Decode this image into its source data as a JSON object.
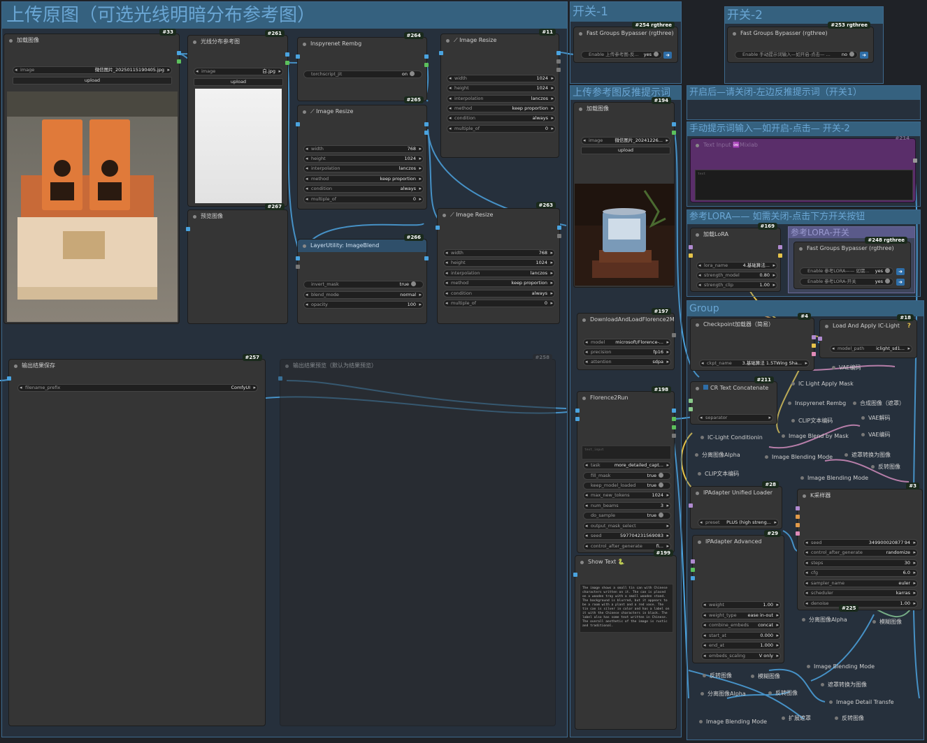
{
  "groups": {
    "main": "上传原图（可选光线明暗分布参考图）",
    "switch1": "开关-1",
    "switch2": "开关-2",
    "ref_reverse": "上传参考图反推提示词",
    "after_open": "开启后—请关闭-左边反推提示词（开关1）",
    "manual_prompt": "手动提示词输入—如开启-点击— 开关-2",
    "ref_lora": "参考LORA—— 如需关闭-点击下方开关按钮",
    "lora_switch": "参考LORA-开关",
    "group": "Group"
  },
  "nodes": {
    "load_image": {
      "title": "加载图像",
      "id": "#33",
      "image_label": "image",
      "image_value": "微信图片_20250115190405.jpg",
      "upload": "upload"
    },
    "light_ref": {
      "title": "光线分布参考图",
      "id": "#261",
      "image_label": "image",
      "image_value": "白.jpg",
      "upload": "upload"
    },
    "preview": {
      "title": "预览图像",
      "id": "#267"
    },
    "inspyrenet": {
      "title": "Inspyrenet Rembg",
      "id": "#264",
      "w_label": "torchscript_jit",
      "w_value": "on"
    },
    "resize265": {
      "title": "Image Resize",
      "id": "#265",
      "widgets": [
        [
          "width",
          "768"
        ],
        [
          "height",
          "1024"
        ],
        [
          "interpolation",
          "lanczos"
        ],
        [
          "method",
          "keep proportion"
        ],
        [
          "condition",
          "always"
        ],
        [
          "multiple_of",
          "0"
        ]
      ]
    },
    "resize11": {
      "title": "Image Resize",
      "id": "#11",
      "widgets": [
        [
          "width",
          "1024"
        ],
        [
          "height",
          "1024"
        ],
        [
          "interpolation",
          "lanczos"
        ],
        [
          "method",
          "keep proportion"
        ],
        [
          "condition",
          "always"
        ],
        [
          "multiple_of",
          "0"
        ]
      ]
    },
    "resize263": {
      "title": "Image Resize",
      "id": "#263",
      "widgets": [
        [
          "width",
          "768"
        ],
        [
          "height",
          "1024"
        ],
        [
          "interpolation",
          "lanczos"
        ],
        [
          "method",
          "keep proportion"
        ],
        [
          "condition",
          "always"
        ],
        [
          "multiple_of",
          "0"
        ]
      ]
    },
    "blend266": {
      "title": "LayerUtility: ImageBlend",
      "id": "#266",
      "widgets": [
        [
          "invert_mask",
          "true"
        ],
        [
          "blend_mode",
          "normal"
        ],
        [
          "opacity",
          "100"
        ]
      ]
    },
    "save257": {
      "title": "输出结果保存",
      "id": "#257",
      "prefix_label": "filename_prefix",
      "prefix_value": "ComfyUI"
    },
    "preview258": {
      "title": "输出结果预览（默认为结果预览）",
      "id": "#258"
    },
    "bypass254": {
      "title": "Fast Groups Bypasser (rgthree)",
      "id": "#254 rgthree",
      "toggle_label": "Enable 上传参考图-反...",
      "toggle_value": "yes"
    },
    "bypass253": {
      "title": "Fast Groups Bypasser (rgthree)",
      "id": "#253 rgthree",
      "toggle_label": "Enable 手动提示词输入—如开启-点击— ...",
      "toggle_value": "no"
    },
    "load194": {
      "title": "加载图像",
      "id": "#194",
      "image_label": "image",
      "image_value": "微信图片_20241226...",
      "upload": "upload"
    },
    "florence197": {
      "title": "DownloadAndLoadFlorence2Model",
      "id": "#197",
      "widgets": [
        [
          "model",
          "microsoft/Florence-..."
        ],
        [
          "precision",
          "fp16"
        ],
        [
          "attention",
          "sdpa"
        ]
      ]
    },
    "florence_run": {
      "title": "Florence2Run",
      "id": "#198",
      "text_placeholder": "text_input",
      "widgets": [
        [
          "task",
          "more_detailed_capt..."
        ],
        [
          "fill_mask",
          "true"
        ],
        [
          "keep_model_loaded",
          "true"
        ],
        [
          "max_new_tokens",
          "1024"
        ],
        [
          "num_beams",
          "3"
        ],
        [
          "do_sample",
          "true"
        ],
        [
          "output_mask_select",
          ""
        ],
        [
          "seed",
          "597704231569083"
        ],
        [
          "control_after_generate",
          "fi..."
        ]
      ]
    },
    "show_text": {
      "title": "Show Text 🐍",
      "id": "#199",
      "text": "The image shows a small tin can with Chinese characters written on it. The can is placed on a wooden tray with a small wooden stand. The background is blurred, but it appears to be a room with a plant and a red vase. The tin can is silver in color and has a label on it with the Chinese characters in black. The label also has some text written in Chinese. The overall aesthetic of the image is rustic and traditional."
    },
    "text_input214": {
      "title": "Text Input ♾️Mixlab",
      "id": "#214",
      "placeholder": "text"
    },
    "lora169": {
      "title": "加载LoRA",
      "id": "#169",
      "widgets": [
        [
          "lora_name",
          "4.基础算法..."
        ],
        [
          "strength_model",
          "0.80"
        ],
        [
          "strength_clip",
          "1.00"
        ]
      ]
    },
    "bypass248": {
      "title": "Fast Groups Bypasser (rgthree)",
      "id": "#248 rgthree",
      "toggles": [
        [
          "Enable 参考LORA—— 如需...",
          "yes"
        ],
        [
          "Enable 参考LORA-开关",
          "yes"
        ]
      ]
    },
    "ckpt4": {
      "title": "Checkpoint加载器（简易）",
      "id": "#4",
      "ckpt_label": "ckpt_name",
      "ckpt_value": "3.基础算法 1.5TWing Sha..."
    },
    "iclight18": {
      "title": "Load And Apply IC-Light",
      "id": "#18",
      "model_label": "model_path",
      "model_value": "iclight_sd1..."
    },
    "cr211": {
      "title": "CR Text Concatenate",
      "id": "#211",
      "sep_label": "separator"
    },
    "ipa_loader28": {
      "title": "IPAdapter Unified Loader",
      "id": "#28",
      "preset_label": "preset",
      "preset_value": "PLUS (high streng..."
    },
    "ipa_adv29": {
      "title": "IPAdapter Advanced",
      "id": "#29",
      "widgets": [
        [
          "weight",
          "1.00"
        ],
        [
          "weight_type",
          "ease in-out"
        ],
        [
          "combine_embeds",
          "concat"
        ],
        [
          "start_at",
          "0.000"
        ],
        [
          "end_at",
          "1.000"
        ],
        [
          "embeds_scaling",
          "V only"
        ]
      ]
    },
    "ksampler3": {
      "title": "K采样器",
      "id": "#3",
      "widgets": [
        [
          "seed",
          "349900020877 94"
        ],
        [
          "control_after_generate",
          "randomize"
        ],
        [
          "steps",
          "30"
        ],
        [
          "cfg",
          "6.0"
        ],
        [
          "sampler_name",
          "euler"
        ],
        [
          "scheduler",
          "karras"
        ],
        [
          "denoise",
          "1.00"
        ]
      ]
    },
    "id225": "#225"
  },
  "small_nodes": [
    "VAE编码",
    "IC Light Apply Mask",
    "Inspyrenet Rembg",
    "合成图像（遮罩）",
    "CLIP文本编码",
    "VAE解码",
    "IC-Light Conditionin",
    "Image Blend by Mask",
    "VAE编码",
    "分离图像Alpha",
    "Image Blending Mode",
    "遮罩转换为图像",
    "反转图像",
    "CLIP文本编码",
    "Image Blending Mode",
    "分离图像Alpha",
    "模糊图像",
    "反转图像",
    "模糊图像",
    "Image Blending Mode",
    "遮罩转换为图像",
    "分离图像Alpha",
    "反转图像",
    "Image Detail Transfe",
    "Image Blending Mode",
    "扩展遮罩",
    "反转图像"
  ],
  "colors": {
    "wire_blue": "#4aa3df",
    "wire_yellow": "#e5c34a",
    "wire_pink": "#e08ab8",
    "wire_green": "#8ac98a",
    "wire_orange": "#e09a4a",
    "group_title": "#6aa6d4",
    "badge_bg": "#1a2a1c"
  }
}
